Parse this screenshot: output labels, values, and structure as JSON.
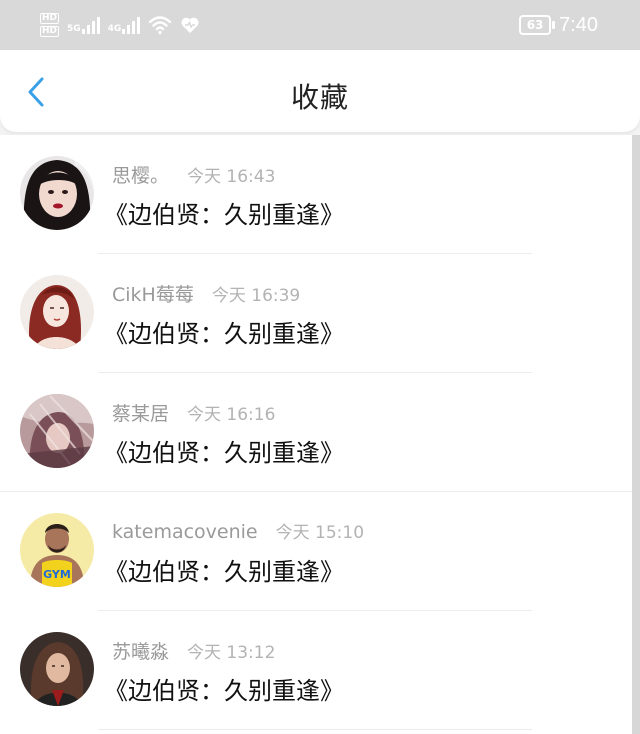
{
  "status_bar": {
    "hd1": "HD",
    "hd2": "HD",
    "net1": "5G",
    "net2": "4G",
    "battery": "63",
    "time": "7:40"
  },
  "header": {
    "title": "收藏",
    "back_icon": "chevron-left-icon",
    "accent": "#3aa0e8"
  },
  "items": [
    {
      "name": "思樱。",
      "time": "今天 16:43",
      "content": "《边伯贤：久别重逢》"
    },
    {
      "name": "CikH莓莓",
      "time": "今天 16:39",
      "content": "《边伯贤：久别重逢》"
    },
    {
      "name": "蔡某居",
      "time": "今天 16:16",
      "content": "《边伯贤：久别重逢》"
    },
    {
      "name": "katemacovenie",
      "time": "今天 15:10",
      "content": "《边伯贤：久别重逢》",
      "avatar_text": "GYM"
    },
    {
      "name": "苏曦淼",
      "time": "今天 13:12",
      "content": "《边伯贤：久别重逢》"
    }
  ]
}
